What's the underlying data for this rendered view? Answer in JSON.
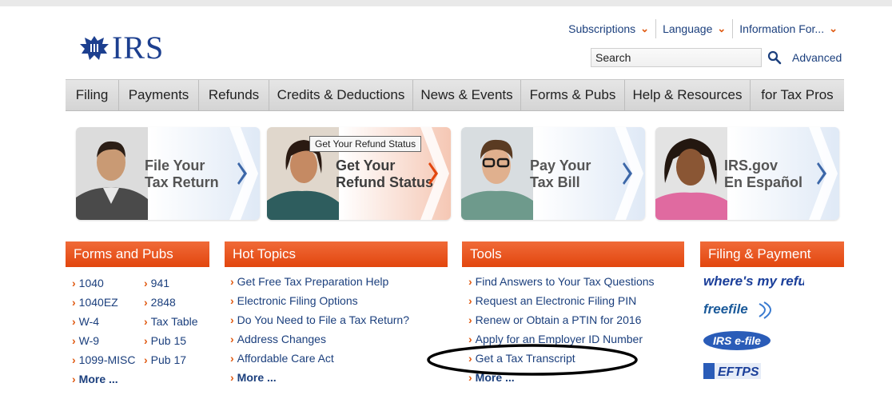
{
  "header": {
    "logo_text": "IRS",
    "utility_links": [
      {
        "label": "Subscriptions"
      },
      {
        "label": "Language"
      },
      {
        "label": "Information For..."
      }
    ],
    "search_value": "Search",
    "advanced_label": "Advanced"
  },
  "nav": {
    "items": [
      {
        "label": "Filing"
      },
      {
        "label": "Payments"
      },
      {
        "label": "Refunds"
      },
      {
        "label": "Credits & Deductions"
      },
      {
        "label": "News & Events"
      },
      {
        "label": "Forms & Pubs"
      },
      {
        "label": "Help & Resources"
      },
      {
        "label": "for Tax Pros"
      }
    ]
  },
  "promos": [
    {
      "line1": "File Your",
      "line2": "Tax Return"
    },
    {
      "line1": "Get Your",
      "line2": "Refund Status",
      "tooltip": "Get Your Refund Status"
    },
    {
      "line1": "Pay Your",
      "line2": "Tax Bill"
    },
    {
      "line1": "IRS.gov",
      "line2": "En Español"
    }
  ],
  "forms": {
    "title": "Forms and Pubs",
    "col1": [
      "1040",
      "1040EZ",
      "W-4",
      "W-9",
      "1099-MISC"
    ],
    "col2": [
      "941",
      "2848",
      "Tax Table",
      "Pub 15",
      "Pub 17"
    ],
    "more": "More ..."
  },
  "hot_topics": {
    "title": "Hot Topics",
    "items": [
      "Get Free Tax Preparation Help",
      "Electronic Filing Options",
      "Do You Need to File a Tax Return?",
      "Address Changes",
      "Affordable Care Act"
    ],
    "more": "More ..."
  },
  "tools": {
    "title": "Tools",
    "items": [
      "Find Answers to Your Tax Questions",
      "Request an Electronic Filing PIN",
      "Renew or Obtain a PTIN for 2016",
      "Apply for an Employer ID Number",
      "Get a Tax Transcript"
    ],
    "more": "More ..."
  },
  "filing": {
    "title": "Filing & Payment",
    "logos": [
      "where's my refund?",
      "freefile",
      "IRS e-file",
      "EFTPS"
    ]
  },
  "colors": {
    "accent_orange": "#e2460e",
    "link_blue": "#1b3f7d",
    "logo_blue": "#1c3f8f"
  }
}
